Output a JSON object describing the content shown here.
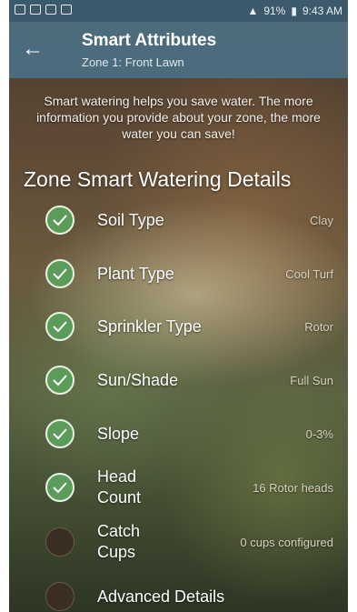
{
  "status_bar": {
    "battery": "91%",
    "time": "9:43 AM"
  },
  "app_bar": {
    "back_icon": "arrow-left-icon",
    "title": "Smart Attributes",
    "subtitle": "Zone 1: Front Lawn"
  },
  "intro_text": "Smart watering helps you save water. The more information you provide about your zone, the more water you can save!",
  "section_title": "Zone Smart Watering Details",
  "attributes": [
    {
      "label": "Soil Type",
      "value": "Clay",
      "completed": true
    },
    {
      "label": "Plant Type",
      "value": "Cool Turf",
      "completed": true
    },
    {
      "label": "Sprinkler Type",
      "value": "Rotor",
      "completed": true
    },
    {
      "label": "Sun/Shade",
      "value": "Full Sun",
      "completed": true
    },
    {
      "label": "Slope",
      "value": "0-3%",
      "completed": true
    },
    {
      "label_line1": "Head",
      "label_line2": "Count",
      "value": "16 Rotor heads",
      "completed": true
    },
    {
      "label_line1": "Catch",
      "label_line2": "Cups",
      "value": "0 cups configured",
      "completed": false
    },
    {
      "label": "Advanced Details",
      "value": "",
      "completed": false
    }
  ],
  "colors": {
    "app_bar": "#4c6e80",
    "check": "#5c9c5a"
  }
}
